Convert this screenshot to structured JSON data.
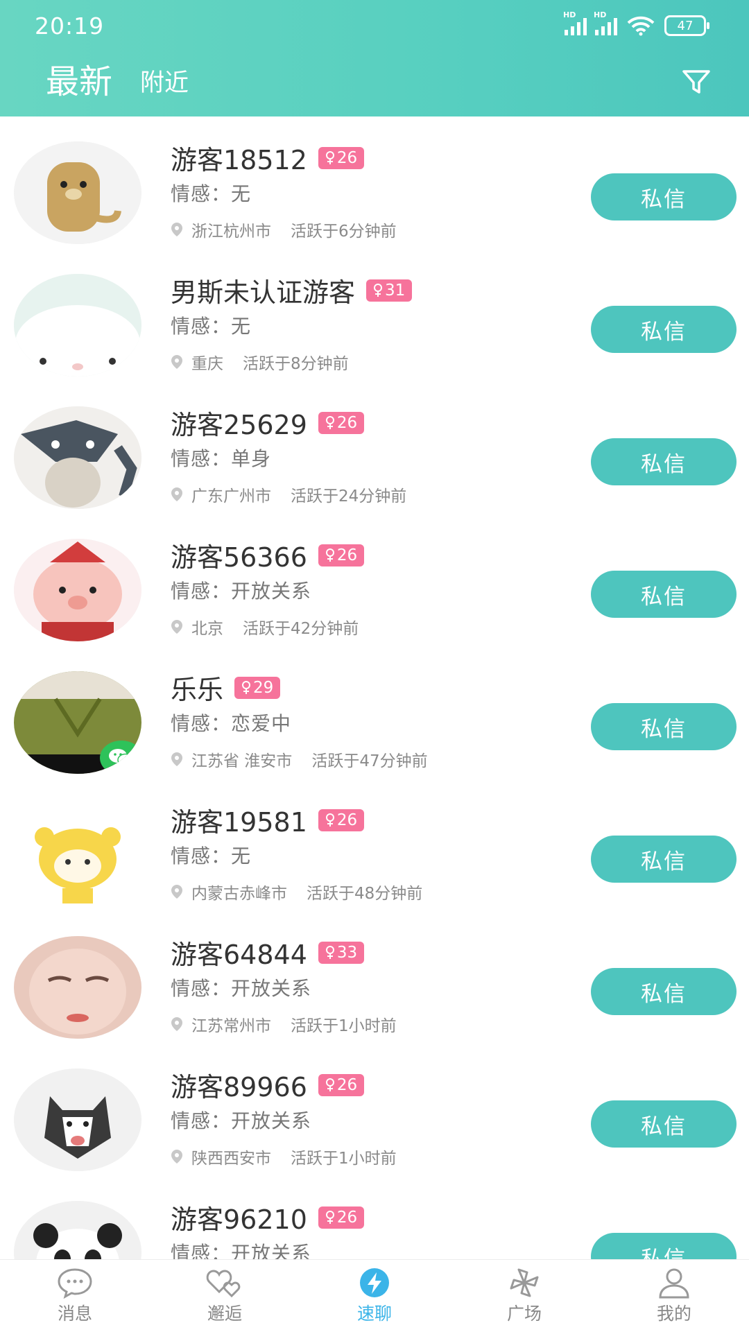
{
  "status": {
    "time": "20:19",
    "battery": "47",
    "signal_label": "HD"
  },
  "header": {
    "tabs": [
      {
        "label": "最新",
        "active": true
      },
      {
        "label": "附近",
        "active": false
      }
    ]
  },
  "list": {
    "emotion_prefix": "情感：",
    "button_label": "私信",
    "users": [
      {
        "name": "游客18512",
        "age": "26",
        "emotion": "无",
        "location": "浙江杭州市",
        "active": "活跃于6分钟前"
      },
      {
        "name": "男斯未认证游客",
        "age": "31",
        "emotion": "无",
        "location": "重庆",
        "active": "活跃于8分钟前"
      },
      {
        "name": "游客25629",
        "age": "26",
        "emotion": "单身",
        "location": "广东广州市",
        "active": "活跃于24分钟前"
      },
      {
        "name": "游客56366",
        "age": "26",
        "emotion": "开放关系",
        "location": "北京",
        "active": "活跃于42分钟前"
      },
      {
        "name": "乐乐",
        "age": "29",
        "emotion": "恋爱中",
        "location": "江苏省 淮安市",
        "active": "活跃于47分钟前"
      },
      {
        "name": "游客19581",
        "age": "26",
        "emotion": "无",
        "location": "内蒙古赤峰市",
        "active": "活跃于48分钟前"
      },
      {
        "name": "游客64844",
        "age": "33",
        "emotion": "开放关系",
        "location": "江苏常州市",
        "active": "活跃于1小时前"
      },
      {
        "name": "游客89966",
        "age": "26",
        "emotion": "开放关系",
        "location": "陕西西安市",
        "active": "活跃于1小时前"
      },
      {
        "name": "游客96210",
        "age": "26",
        "emotion": "开放关系",
        "location": "",
        "active": ""
      }
    ]
  },
  "bottom_nav": [
    {
      "label": "消息",
      "icon": "chat-bubble-icon",
      "active": false
    },
    {
      "label": "邂逅",
      "icon": "hearts-icon",
      "active": false
    },
    {
      "label": "速聊",
      "icon": "lightning-icon",
      "active": true
    },
    {
      "label": "广场",
      "icon": "pinwheel-icon",
      "active": false
    },
    {
      "label": "我的",
      "icon": "person-icon",
      "active": false
    }
  ],
  "colors": {
    "accent": "#4ec5be",
    "badge": "#f6739b",
    "nav_active": "#3bb4e8"
  }
}
